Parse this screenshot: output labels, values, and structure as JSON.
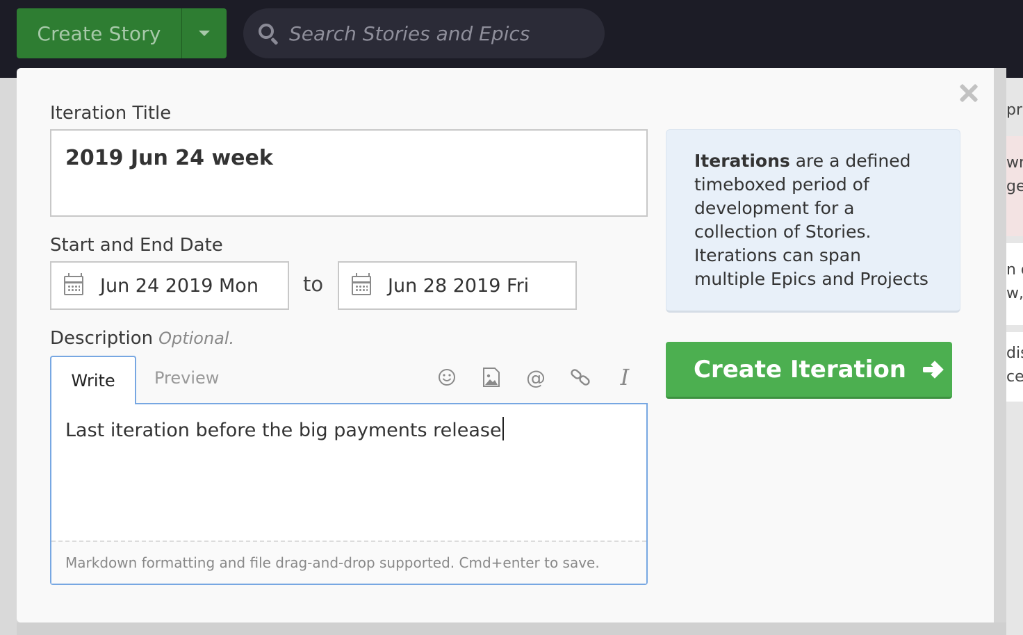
{
  "topbar": {
    "create_story_label": "Create Story",
    "search_placeholder": "Search Stories and Epics"
  },
  "background": {
    "cards": [
      "pr",
      "wn",
      "ge",
      "n d",
      "w,",
      "dis",
      "ce"
    ]
  },
  "modal": {
    "title_label": "Iteration Title",
    "title_value": "2019 Jun 24 week",
    "date_label": "Start and End Date",
    "start_date": "Jun 24 2019 Mon",
    "to_label": "to",
    "end_date": "Jun 28 2019 Fri",
    "description_label": "Description",
    "optional_label": "Optional.",
    "tabs": {
      "write": "Write",
      "preview": "Preview"
    },
    "toolbar_icons": [
      "emoji-icon",
      "image-icon",
      "mention-icon",
      "link-icon",
      "italic-icon"
    ],
    "description_value": "Last iteration before the big payments release",
    "editor_hint": "Markdown formatting and file drag-and-drop supported. Cmd+enter to save.",
    "info": {
      "bold": "Iterations",
      "text": " are a defined timeboxed period of development for a collection of Stories. Iterations can span multiple Epics and Projects"
    },
    "primary_button": "Create Iteration"
  },
  "colors": {
    "topbar_bg": "#1c1c26",
    "create_story_bg": "#2e7d32",
    "primary_green": "#4caf50",
    "info_bg": "#e8f0f9",
    "focus_blue": "#77a7e2"
  }
}
